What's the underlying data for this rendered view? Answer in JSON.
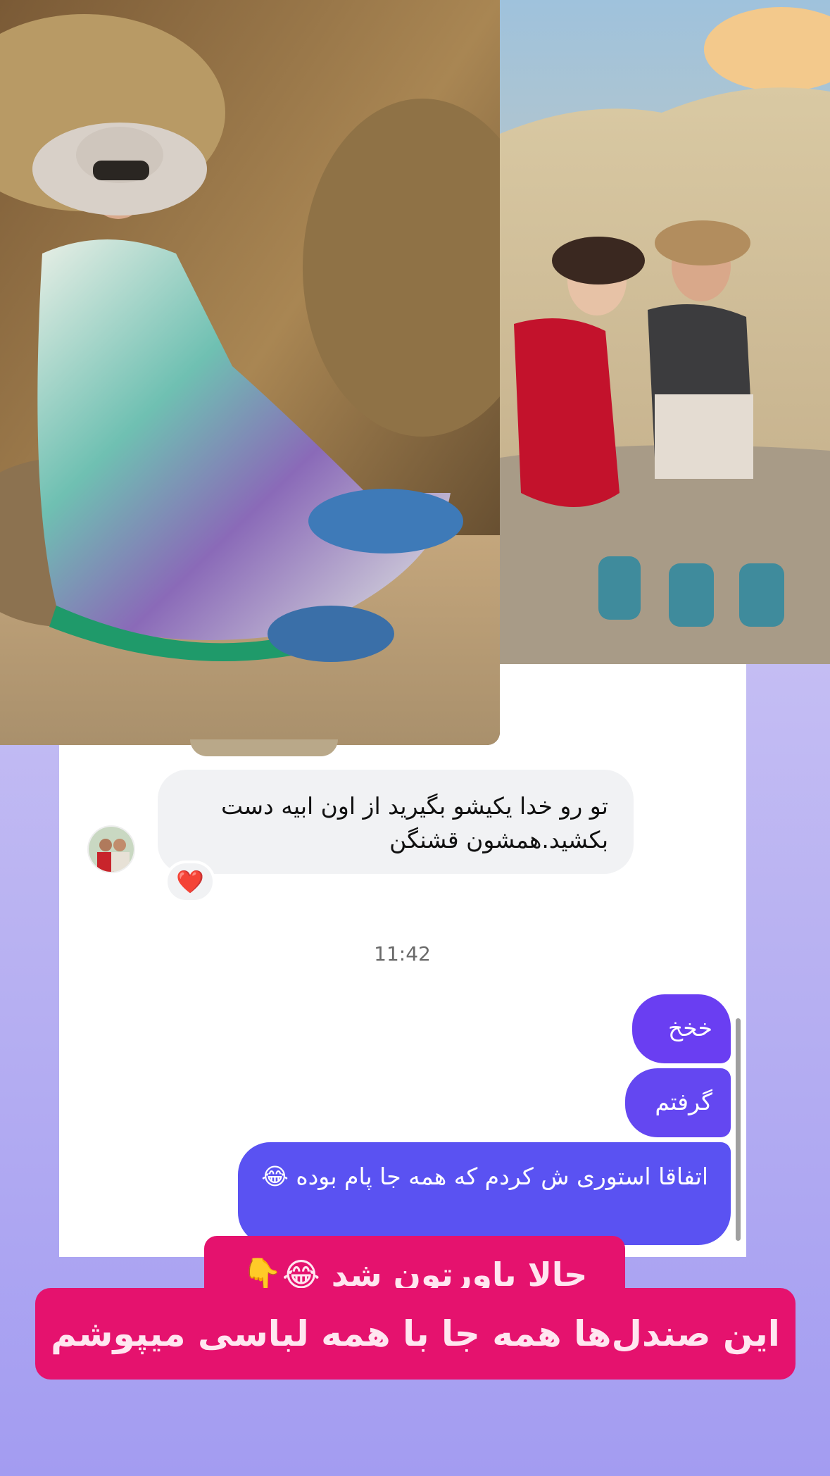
{
  "photos": {
    "left": {
      "icon": "photo-woman-in-cave"
    },
    "right": {
      "icon": "photo-couple-on-rocks"
    }
  },
  "chat": {
    "incoming_message": "تو رو خدا یکیشو بگیرید از اون ابیه دست بکشید.همشون قشنگن",
    "reaction": "❤️",
    "timestamp": "11:42",
    "outgoing_messages": [
      "خخخ",
      "گرفتم",
      "اتفاقا استوری ش کردم که همه جا پام بوده 😂"
    ]
  },
  "captions": {
    "line1": "حالا باورتون شد 😂👇",
    "line2": "این صندل‌ها همه جا با همه لباسی میپوشم"
  },
  "colors": {
    "background_top": "#d7d3f6",
    "background_bottom": "#a39cf1",
    "bubble_purple": "#6a3ef2",
    "bubble_blue": "#5a52f2",
    "caption_pink": "#e5126e"
  }
}
